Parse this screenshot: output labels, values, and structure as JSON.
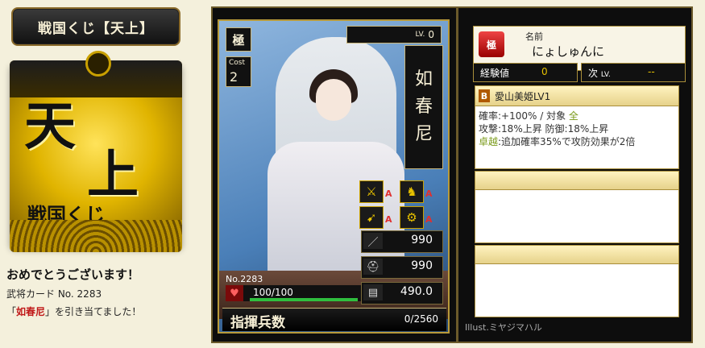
{
  "lottery": {
    "title": "戦国くじ【天上】",
    "ticket_main_1": "天",
    "ticket_main_2": "上",
    "ticket_sub": "戦国くじ"
  },
  "result": {
    "congrats": "おめでとうございます！",
    "card_label": "武将カード No. 2283",
    "draw_prefix": "「",
    "draw_name": "如春尼",
    "draw_suffix": "」を引き当てました！"
  },
  "card": {
    "rank": "極",
    "cost_label": "Cost",
    "cost": "2",
    "level_label": "LV.",
    "level": "0",
    "name_chars": [
      "如",
      "春",
      "尼"
    ],
    "skill_grades": [
      {
        "icon": "spear-icon",
        "grade": "A"
      },
      {
        "icon": "cavalry-icon",
        "grade": "A"
      },
      {
        "icon": "bow-icon",
        "grade": "A"
      },
      {
        "icon": "siege-icon",
        "grade": "A"
      }
    ],
    "attack": "990",
    "defense": "990",
    "intellect": "490.0",
    "number": "No.2283",
    "hp": "100/100",
    "hp_fraction": 1.0,
    "troops_label": "指揮兵数",
    "troops": "0/2560"
  },
  "detail": {
    "rank_icon_text": "極",
    "name_label": "名前",
    "name_reading": "にょしゅんに",
    "exp_label": "経験値",
    "exp_value": "0",
    "next_label": "次",
    "next_lv_label": "LV.",
    "next_value": "--",
    "skill": {
      "rank": "B",
      "name": "愛山美姫LV1",
      "line1": "確率:+100%  /  対象 ",
      "line1_target": "全",
      "line2": "攻撃:18%上昇  防御:18%上昇",
      "line3_label": "卓越",
      "line3": ":追加確率35%で攻防効果が2倍"
    },
    "illustrator": "Illust.ミヤジマハル"
  }
}
